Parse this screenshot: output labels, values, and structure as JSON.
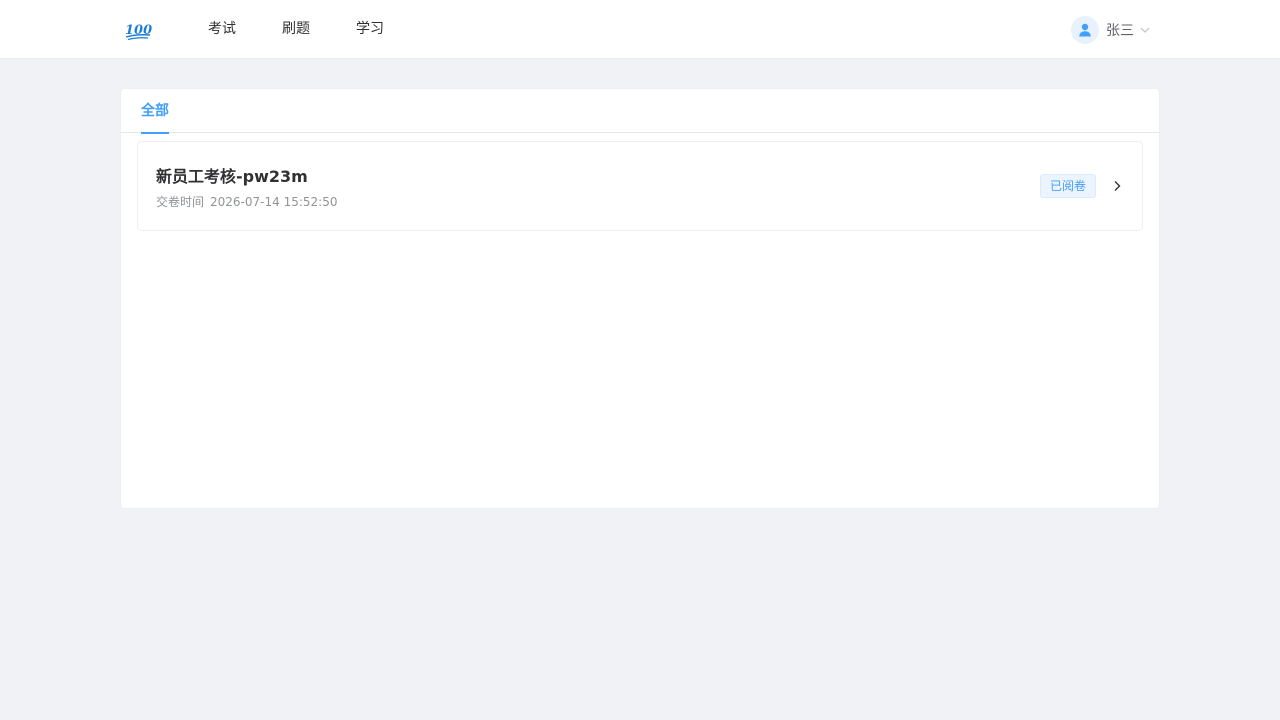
{
  "header": {
    "logo_text": "100",
    "nav": [
      {
        "label": "考试"
      },
      {
        "label": "刷题"
      },
      {
        "label": "学习"
      }
    ],
    "user": {
      "name": "张三"
    }
  },
  "tabs": [
    {
      "label": "全部",
      "active": true
    }
  ],
  "records": [
    {
      "title": "新员工考核-pw23m",
      "submit_label": "交卷时间",
      "submit_time": "2026-07-14 15:52:50",
      "status": "已阅卷"
    }
  ],
  "colors": {
    "accent": "#409eff",
    "background": "#f0f2f5",
    "badge_bg": "#ecf5ff"
  },
  "icons": {
    "logo": "hundred-points-logo",
    "avatar": "user-icon",
    "dropdown": "chevron-down-icon",
    "row_action": "chevron-right-icon"
  }
}
